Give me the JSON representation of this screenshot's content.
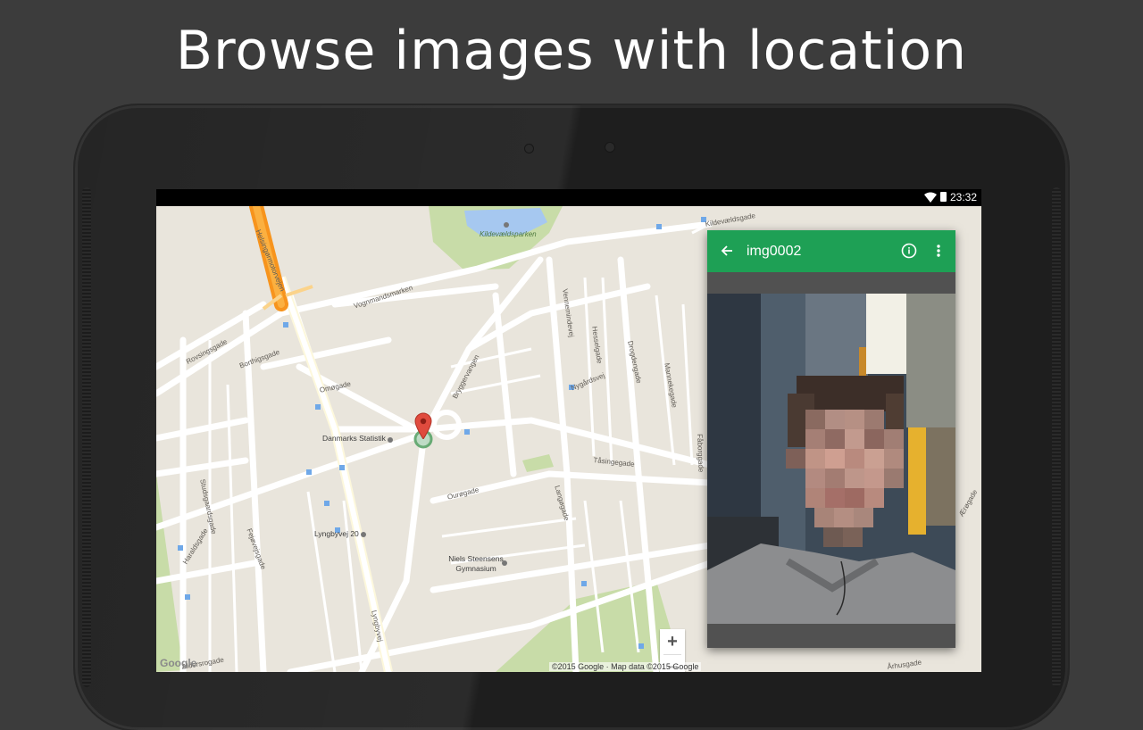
{
  "headline": "Browse images with location",
  "status_bar": {
    "time": "23:32"
  },
  "map": {
    "street_labels": [
      "Helsingørmotorvejen",
      "Kildevældsparken",
      "Vognmandsmarken",
      "Rovsingsgade",
      "Borthigsgade",
      "Omøgade",
      "Bryggervangen",
      "Vennemindevej",
      "Hesselgade",
      "Drogdengade",
      "Mannekegade",
      "Nygårdsvej",
      "Tåsingegade",
      "Ourøgade",
      "Langøgade",
      "Studsgaardsgade",
      "Fejøvejsgade",
      "Haraldsgade",
      "Lyngbyvej",
      "Aldersrogade",
      "Kildevældsgade",
      "Ærøgade",
      "Fåborggade",
      "Århusgade"
    ],
    "poi_labels": [
      "Danmarks Statistik",
      "Lyngbyvej 20",
      "Niels Steensens Gymnasium"
    ],
    "zoom_in": "+",
    "zoom_out": "−",
    "logo": "Google",
    "attribution": "©2015 Google · Map data ©2015 Google"
  },
  "card": {
    "title": "img0002",
    "back_icon": "arrow-left-icon",
    "info_icon": "info-circle-icon",
    "more_icon": "more-vertical-icon"
  },
  "colors": {
    "appbar": "#1ea055",
    "map_background": "#e9e5dc",
    "motorway": "#f7941d",
    "park": "#c8dca8",
    "water": "#a6c8f0"
  }
}
